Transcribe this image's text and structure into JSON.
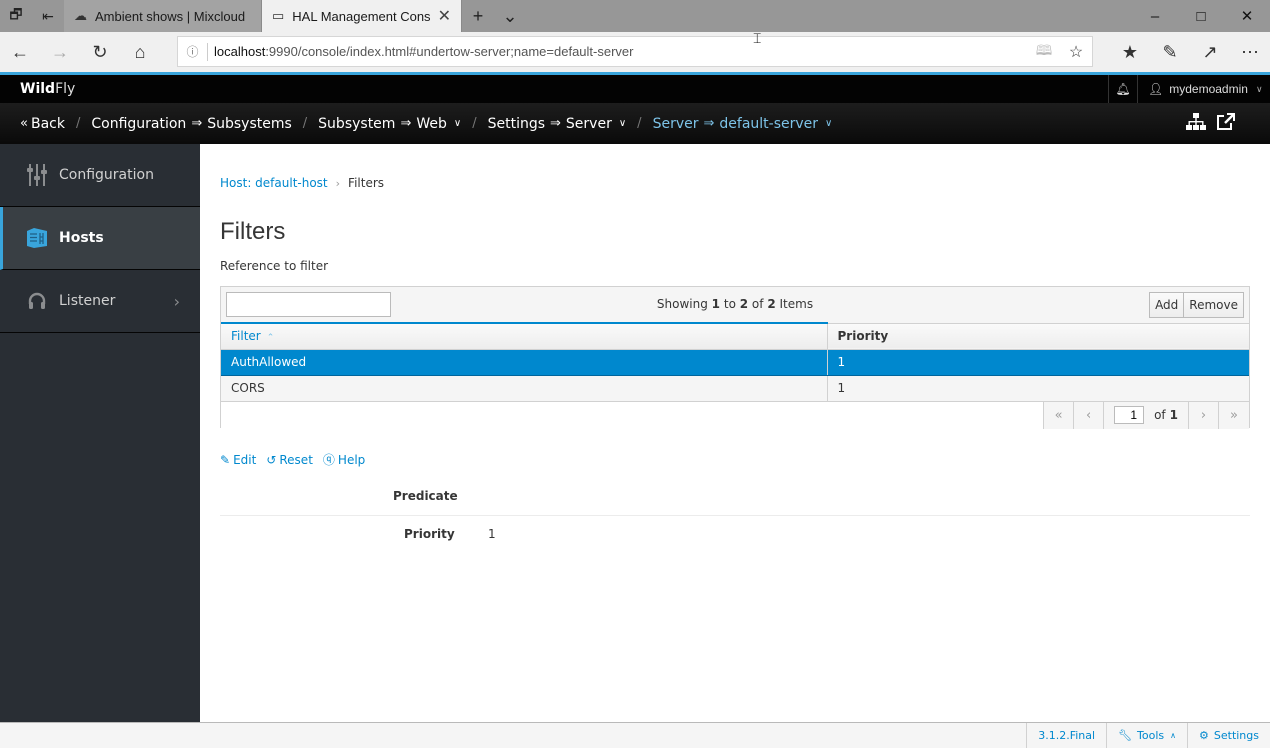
{
  "browser": {
    "tabs": [
      {
        "label": "Ambient shows | Mixcloud",
        "icon": "cloud-icon",
        "active": false
      },
      {
        "label": "HAL Management Cons",
        "icon": "window-icon",
        "active": true
      }
    ],
    "url_host": "localhost",
    "url_rest": ":9990/console/index.html#undertow-server;name=default-server"
  },
  "header": {
    "brand_bold": "Wild",
    "brand_light": "Fly",
    "user": "mydemoadmin"
  },
  "breadcrumb": {
    "back": "Back",
    "items": [
      {
        "a": "Configuration",
        "b": "Subsystems"
      },
      {
        "a": "Subsystem",
        "b": "Web"
      },
      {
        "a": "Settings",
        "b": "Server"
      },
      {
        "a": "Server",
        "b": "default-server"
      }
    ],
    "arrow": "⇒"
  },
  "sidebar": {
    "items": [
      {
        "label": "Configuration"
      },
      {
        "label": "Hosts"
      },
      {
        "label": "Listener"
      }
    ]
  },
  "main": {
    "crumb_link": "Host: default-host",
    "crumb_current": "Filters",
    "title": "Filters",
    "description": "Reference to filter",
    "table": {
      "search_placeholder": "",
      "info_prefix": "Showing",
      "info_from": "1",
      "info_to_word": "to",
      "info_to": "2",
      "info_of_word": "of",
      "info_total": "2",
      "info_suffix": "Items",
      "add_label": "Add",
      "remove_label": "Remove",
      "columns": [
        "Filter",
        "Priority"
      ],
      "rows": [
        {
          "filter": "AuthAllowed",
          "priority": "1",
          "selected": true
        },
        {
          "filter": "CORS",
          "priority": "1",
          "selected": false
        }
      ],
      "page_current": "1",
      "page_of": "of",
      "page_total": "1"
    },
    "actions": {
      "edit": "Edit",
      "reset": "Reset",
      "help": "Help"
    },
    "form": {
      "predicate_label": "Predicate",
      "predicate_value": "",
      "priority_label": "Priority",
      "priority_value": "1"
    }
  },
  "footer": {
    "version": "3.1.2.Final",
    "tools": "Tools",
    "settings": "Settings"
  },
  "colors": {
    "accent": "#0088ce",
    "sidebar_bg": "#292e34",
    "header_bg": "#030303",
    "active_indicator": "#39a5dc"
  }
}
